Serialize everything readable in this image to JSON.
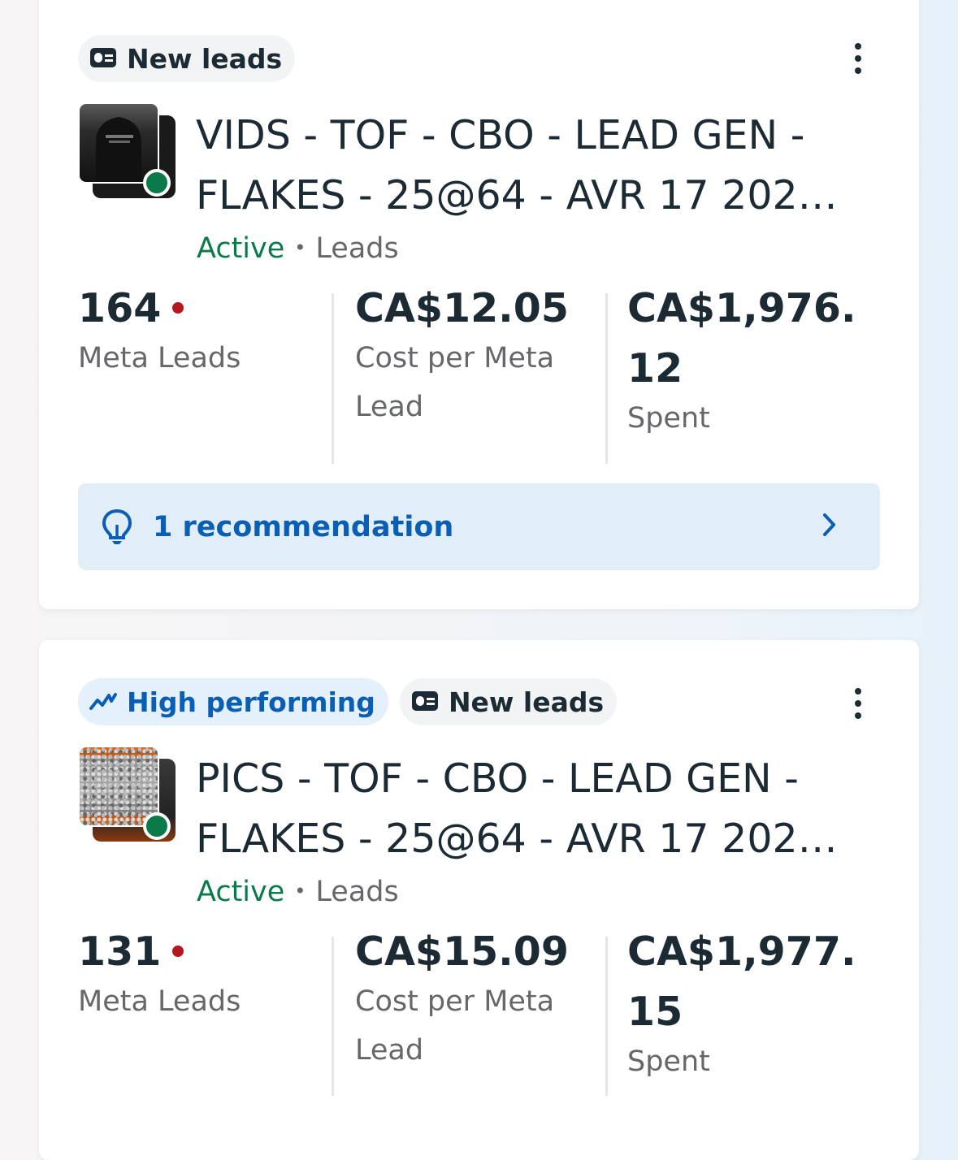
{
  "campaigns": [
    {
      "chips": [
        {
          "label": "New leads",
          "icon": "lead-card-icon"
        }
      ],
      "title_line1": "VIDS - TOF - CBO - LEAD GEN -",
      "title_line2": "FLAKES - 25@64 - AVR 17 202…",
      "status": "Active",
      "objective": "Leads",
      "metrics": [
        {
          "value": "164",
          "label": "Meta Leads"
        },
        {
          "value": "CA$12.05",
          "label": "Cost per Meta Lead"
        },
        {
          "value": "CA$1,976.12",
          "label": "Spent"
        }
      ],
      "recommendation": "1 recommendation"
    },
    {
      "chips": [
        {
          "label": "High performing",
          "icon": "trend-up-icon"
        },
        {
          "label": "New leads",
          "icon": "lead-card-icon"
        }
      ],
      "title_line1": "PICS - TOF - CBO - LEAD GEN -",
      "title_line2": "FLAKES - 25@64 - AVR 17 202…",
      "status": "Active",
      "objective": "Leads",
      "metrics": [
        {
          "value": "131",
          "label": "Meta Leads"
        },
        {
          "value": "CA$15.09",
          "label": "Cost per Meta Lead"
        },
        {
          "value": "CA$1,977.15",
          "label": "Spent"
        }
      ]
    }
  ],
  "colors": {
    "active_green": "#0a7a4a",
    "accent_blue": "#0a5fb4",
    "alert_red": "#b3161b",
    "reco_bg": "#e1eef8"
  }
}
